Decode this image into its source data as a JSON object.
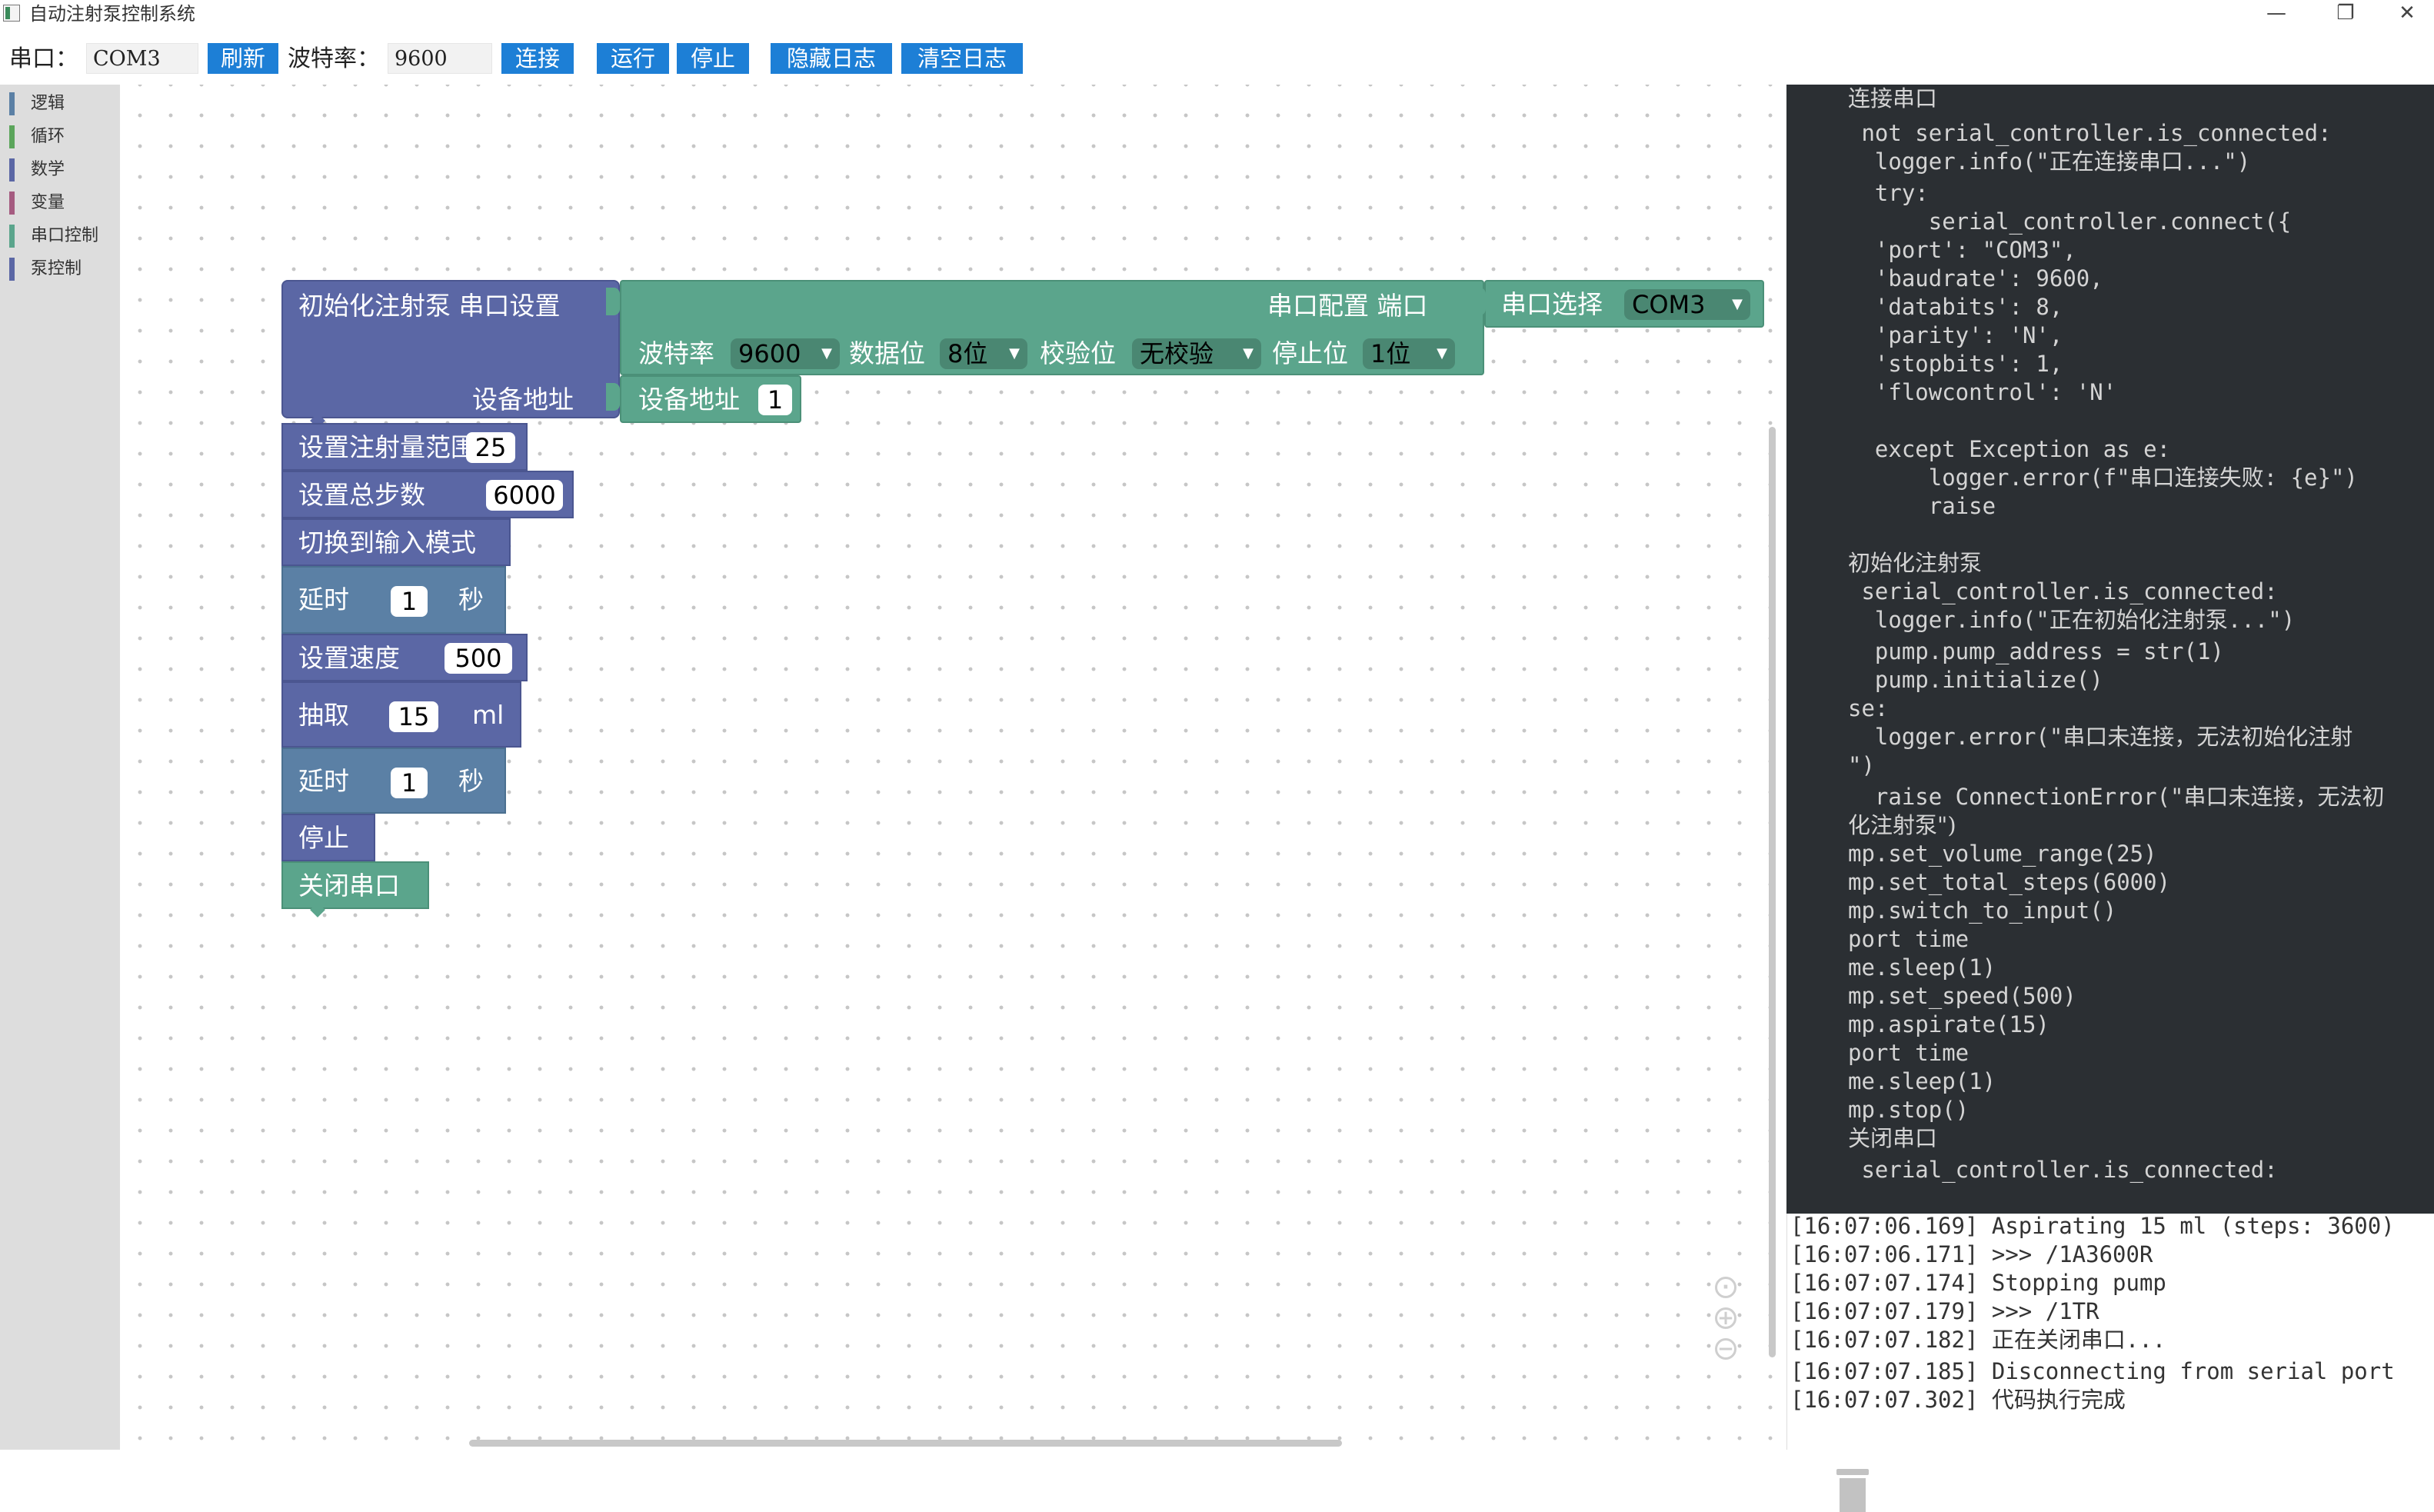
{
  "window": {
    "title": "自动注射泵控制系统",
    "controls": {
      "minimize": "—",
      "restore": "❐",
      "close": "✕"
    }
  },
  "toolbar": {
    "port_label": "串口：",
    "port_value": "COM3",
    "refresh": "刷新",
    "baud_label": "波特率：",
    "baud_value": "9600",
    "connect": "连接",
    "run": "运行",
    "stop": "停止",
    "hide_log": "隐藏日志",
    "clear_log": "清空日志"
  },
  "toolbox": {
    "categories": [
      {
        "label": "逻辑",
        "color": "#5b80a5"
      },
      {
        "label": "循环",
        "color": "#5ba55b"
      },
      {
        "label": "数学",
        "color": "#5b67a5"
      },
      {
        "label": "变量",
        "color": "#a55b80"
      },
      {
        "label": "串口控制",
        "color": "#5ba58c"
      },
      {
        "label": "泵控制",
        "color": "#5b67a5"
      }
    ]
  },
  "blocks": {
    "init": {
      "title": "初始化注射泵 串口设置",
      "addr_label": "设备地址",
      "serial_config": "串口配置 端口",
      "port_select": "串口选择",
      "port_value": "COM3",
      "baud_label": "波特率",
      "baud_value": "9600",
      "databits_label": "数据位",
      "databits_value": "8位",
      "parity_label": "校验位",
      "parity_value": "无校验",
      "stopbits_label": "停止位",
      "stopbits_value": "1位",
      "device_addr_label": "设备地址",
      "device_addr_value": "1"
    },
    "set_range": {
      "label": "设置注射量范围",
      "value": "25"
    },
    "set_steps": {
      "label": "设置总步数",
      "value": "6000"
    },
    "switch_input": {
      "label": "切换到输入模式"
    },
    "delay1": {
      "label": "延时",
      "value": "1",
      "unit": "秒"
    },
    "set_speed": {
      "label": "设置速度",
      "value": "500"
    },
    "aspirate": {
      "label": "抽取",
      "value": "15",
      "unit": "ml"
    },
    "delay2": {
      "label": "延时",
      "value": "1",
      "unit": "秒"
    },
    "stop": {
      "label": "停止"
    },
    "close_serial": {
      "label": "关闭串口"
    }
  },
  "code_lines": [
    "连接串口",
    " not serial_controller.is_connected:",
    "  logger.info(\"正在连接串口...\")",
    "  try:",
    "      serial_controller.connect({",
    "  'port': \"COM3\",",
    "  'baudrate': 9600,",
    "  'databits': 8,",
    "  'parity': 'N',",
    "  'stopbits': 1,",
    "  'flowcontrol': 'N'",
    "",
    "  except Exception as e:",
    "      logger.error(f\"串口连接失败: {e}\")",
    "      raise",
    "",
    "初始化注射泵",
    " serial_controller.is_connected:",
    "  logger.info(\"正在初始化注射泵...\")",
    "  pump.pump_address = str(1)",
    "  pump.initialize()",
    "se:",
    "  logger.error(\"串口未连接，无法初始化注射",
    "\")",
    "  raise ConnectionError(\"串口未连接，无法初",
    "化注射泵\")",
    "mp.set_volume_range(25)",
    "mp.set_total_steps(6000)",
    "mp.switch_to_input()",
    "port time",
    "me.sleep(1)",
    "mp.set_speed(500)",
    "mp.aspirate(15)",
    "port time",
    "me.sleep(1)",
    "mp.stop()",
    "关闭串口",
    " serial_controller.is_connected:"
  ],
  "log_lines": [
    "[16:07:06.169] Aspirating 15 ml (steps: 3600)",
    "[16:07:06.171] >>> /1A3600R",
    "[16:07:07.174] Stopping pump",
    "[16:07:07.179] >>> /1TR",
    "[16:07:07.182] 正在关闭串口...",
    "[16:07:07.185] Disconnecting from serial port",
    "[16:07:07.302] 代码执行完成"
  ]
}
